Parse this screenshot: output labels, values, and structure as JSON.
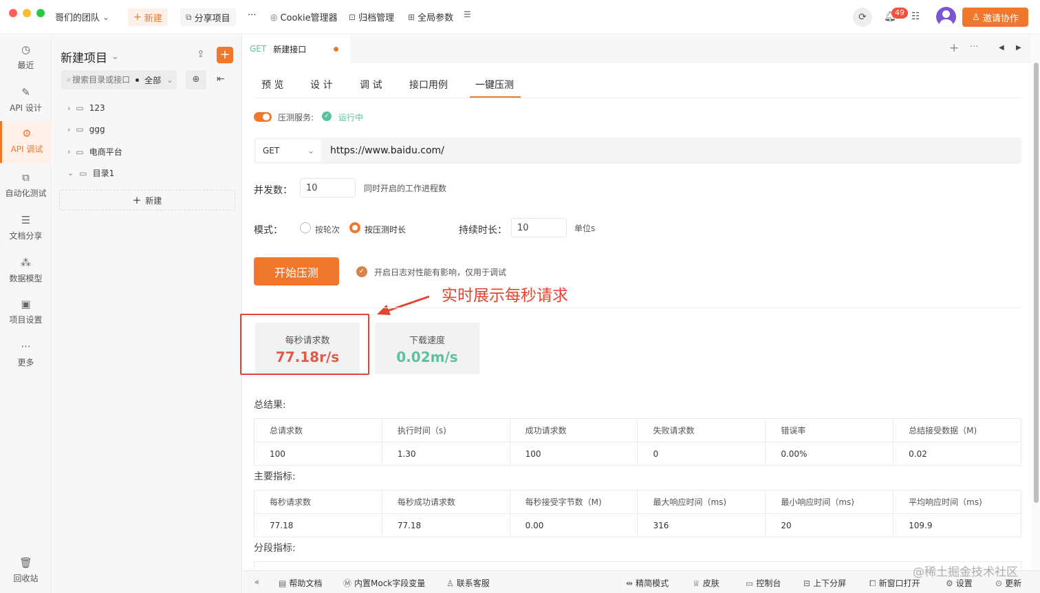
{
  "titlebar": {
    "team": "哥们的团队",
    "new_btn": "新建",
    "share_project": "分享项目",
    "more": "···",
    "cookie_manager": "Cookie管理器",
    "archive_manager": "归档管理",
    "global_params": "全局参数",
    "notif_count": "49",
    "invite_btn": "邀请协作"
  },
  "rail": {
    "items": [
      {
        "label": "最近",
        "icon": "clock-icon"
      },
      {
        "label": "API 设计",
        "icon": "edit-icon"
      },
      {
        "label": "API 调试",
        "icon": "debug-icon"
      },
      {
        "label": "自动化测试",
        "icon": "flow-icon"
      },
      {
        "label": "文档分享",
        "icon": "doc-icon"
      },
      {
        "label": "数据模型",
        "icon": "model-icon"
      },
      {
        "label": "项目设置",
        "icon": "settings-icon"
      },
      {
        "label": "更多",
        "icon": "more-icon"
      }
    ],
    "trash": "回收站"
  },
  "project": {
    "title": "新建项目",
    "search_placeholder": "搜索目录或接口",
    "filter": "全部",
    "tree": [
      "123",
      "ggg",
      "电商平台",
      "目录1"
    ],
    "new_label": "新建"
  },
  "editor": {
    "method_tag": "GET",
    "tab_name": "新建接口",
    "subtabs": [
      "预 览",
      "设 计",
      "调 试",
      "接口用例",
      "一键压测"
    ],
    "active_subtab": "一键压测"
  },
  "stress": {
    "service_label": "压测服务:",
    "service_status": "运行中",
    "method": "GET",
    "url": "https://www.baidu.com/",
    "concurrency_label": "并发数：",
    "concurrency_value": "10",
    "concurrency_hint": "同时开启的工作进程数",
    "mode_label": "模式：",
    "mode_options": [
      "按轮次",
      "按压测时长"
    ],
    "mode_selected": "按压测时长",
    "duration_label": "持续时长：",
    "duration_value": "10",
    "duration_unit": "单位s",
    "start_btn": "开始压测",
    "log_hint": "开启日志对性能有影响，仅用于调试",
    "annotation": "实时展示每秒请求",
    "rps_label": "每秒请求数",
    "rps_value": "77.18r/s",
    "speed_label": "下载速度",
    "speed_value": "0.02m/s"
  },
  "results": {
    "total_title": "总结果:",
    "total_headers": [
      "总请求数",
      "执行时间（s)",
      "成功请求数",
      "失败请求数",
      "错误率",
      "总结接受数据（M)"
    ],
    "total_values": [
      "100",
      "1.30",
      "100",
      "0",
      "0.00%",
      "0.02"
    ],
    "main_title": "主要指标:",
    "main_headers": [
      "每秒请求数",
      "每秒成功请求数",
      "每秒接受字节数（M)",
      "最大响应时间（ms)",
      "最小响应时间（ms)",
      "平均响应时间（ms)"
    ],
    "main_values": [
      "77.18",
      "77.18",
      "0.00",
      "316",
      "20",
      "109.9"
    ],
    "seg_title": "分段指标:"
  },
  "statusbar": {
    "help": "帮助文档",
    "mock": "内置Mock字段变量",
    "support": "联系客服",
    "simple": "精简模式",
    "skin": "皮肤",
    "console": "控制台",
    "split": "上下分屏",
    "new_window": "新窗口打开",
    "settings": "设置",
    "update": "更新"
  },
  "watermark": "@稀土掘金技术社区",
  "colors": {
    "accent": "#f0782d",
    "success": "#52c41a",
    "highlight_red": "#e2452d",
    "speed_green": "#5cc29e"
  }
}
